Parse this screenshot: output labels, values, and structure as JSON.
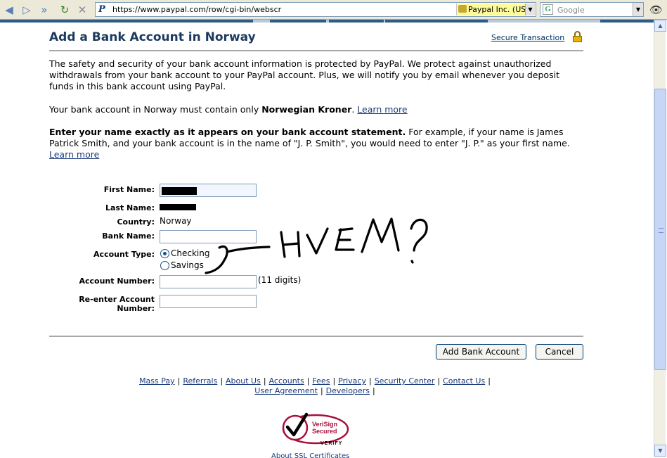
{
  "browser": {
    "url": "https://www.paypal.com/row/cgi-bin/webscr",
    "site_identity": "Paypal Inc. (US)",
    "search_placeholder": "Google"
  },
  "page": {
    "title": "Add a Bank Account in Norway",
    "secure_link": "Secure Transaction",
    "intro": "The safety and security of your bank account information is protected by PayPal. We protect against unauthorized withdrawals from your bank account to your PayPal account. Plus, we will notify you by email whenever you deposit funds in this bank account using PayPal.",
    "currency_pre": "Your bank account in Norway must contain only ",
    "currency_bold": "Norwegian Kroner",
    "currency_post": ".",
    "learn_more": "Learn more",
    "name_bold": "Enter your name exactly as it appears on your bank account statement.",
    "name_rest": " For example, if your name is James Patrick Smith, and your bank account is in the name of \"J. P. Smith\", you would need to enter \"J. P.\" as your first name."
  },
  "form": {
    "first_name_label": "First Name:",
    "last_name_label": "Last Name:",
    "country_label": "Country:",
    "country_value": "Norway",
    "bank_name_label": "Bank Name:",
    "account_type_label": "Account Type:",
    "checking": "Checking",
    "savings": "Savings",
    "account_number_label": "Account Number:",
    "account_number_hint": "(11 digits)",
    "reenter_label_1": "Re-enter Account",
    "reenter_label_2": "Number:"
  },
  "buttons": {
    "add": "Add Bank Account",
    "cancel": "Cancel"
  },
  "footer": {
    "links": [
      "Mass Pay",
      "Referrals",
      "About Us",
      "Accounts",
      "Fees",
      "Privacy",
      "Security Center",
      "Contact Us"
    ],
    "links2": [
      "User Agreement",
      "Developers"
    ]
  },
  "badge": {
    "line1": "VeriSign",
    "line2": "Secured",
    "verify": "VERIFY",
    "below": "About SSL Certificates"
  },
  "annotation": {
    "text": "HVEM?"
  },
  "colors": {
    "heading": "#1c3a5e",
    "link": "#1a3a7a",
    "badge_red": "#a8103b"
  }
}
